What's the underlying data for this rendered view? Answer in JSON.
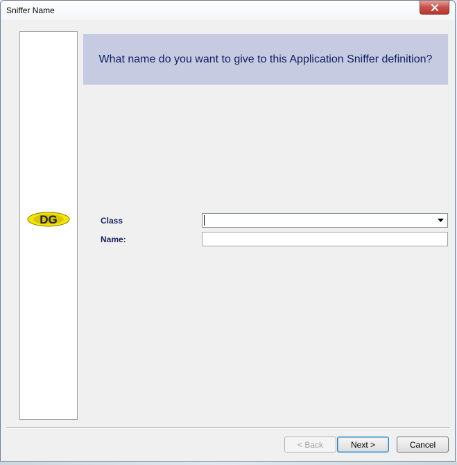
{
  "window": {
    "title": "Sniffer Name"
  },
  "header": {
    "question": "What name do you want to give to this Application Sniffer definition?"
  },
  "logo": {
    "text": "DG"
  },
  "form": {
    "class_label": "Class",
    "class_value": "",
    "name_label": "Name:",
    "name_value": ""
  },
  "buttons": {
    "back": "< Back",
    "next": "Next >",
    "cancel": "Cancel"
  },
  "colors": {
    "header_band": "#c7cbe1",
    "header_text": "#0b1f62",
    "label_text": "#16215e",
    "close_button": "#c75050"
  }
}
